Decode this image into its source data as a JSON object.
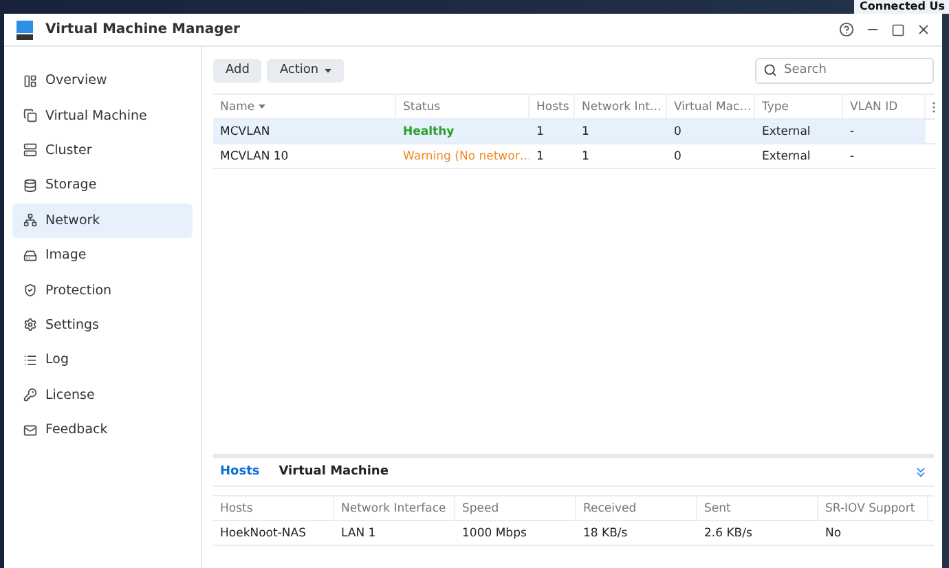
{
  "desktop": {
    "notification": "Connected Us"
  },
  "window": {
    "title": "Virtual Machine Manager"
  },
  "sidebar": {
    "items": [
      {
        "label": "Overview",
        "selected": false
      },
      {
        "label": "Virtual Machine",
        "selected": false
      },
      {
        "label": "Cluster",
        "selected": false
      },
      {
        "label": "Storage",
        "selected": false
      },
      {
        "label": "Network",
        "selected": true
      },
      {
        "label": "Image",
        "selected": false
      },
      {
        "label": "Protection",
        "selected": false
      },
      {
        "label": "Settings",
        "selected": false
      },
      {
        "label": "Log",
        "selected": false
      },
      {
        "label": "License",
        "selected": false
      },
      {
        "label": "Feedback",
        "selected": false
      }
    ]
  },
  "toolbar": {
    "buttons": [
      "Add",
      "Action"
    ],
    "search": {
      "placeholder": "Search"
    }
  },
  "table": {
    "columns": [
      {
        "label": "Name",
        "sorted": true
      },
      {
        "label": "Status",
        "sorted": false
      },
      {
        "label": "Hosts",
        "sorted": false
      },
      {
        "label": "Network Int…",
        "sorted": false
      },
      {
        "label": "Virtual Mac…",
        "sorted": false
      },
      {
        "label": "Type",
        "sorted": false
      },
      {
        "label": "VLAN ID",
        "sorted": false
      }
    ],
    "rows": [
      {
        "selected": true,
        "name": "MCVLAN",
        "status": {
          "text": "Healthy",
          "kind": "healthy"
        },
        "hosts": "1",
        "network_interfaces": "1",
        "virtual_machines": "0",
        "type": "External",
        "vlan_id": "-"
      },
      {
        "selected": false,
        "name": "MCVLAN 10",
        "status": {
          "text": "Warning (No networ…",
          "kind": "warning"
        },
        "hosts": "1",
        "network_interfaces": "1",
        "virtual_machines": "0",
        "type": "External",
        "vlan_id": "-"
      }
    ]
  },
  "detail": {
    "tabs": [
      {
        "label": "Hosts",
        "selected": true
      },
      {
        "label": "Virtual Machine",
        "selected": false
      }
    ],
    "columns": [
      "Hosts",
      "Network Interface",
      "Speed",
      "Received",
      "Sent",
      "SR-IOV Support"
    ],
    "rows": [
      [
        "HoekNoot-NAS",
        "LAN 1",
        "1000 Mbps",
        "18 KB/s",
        "2.6 KB/s",
        "No"
      ]
    ]
  }
}
